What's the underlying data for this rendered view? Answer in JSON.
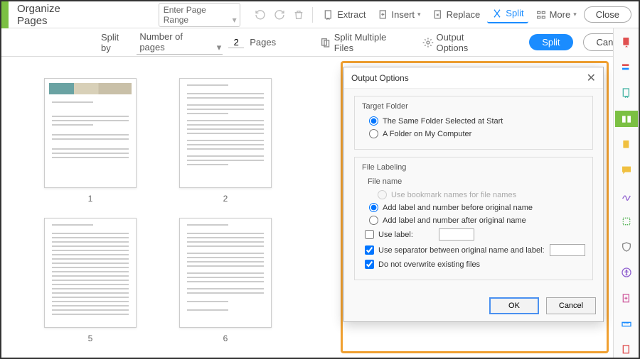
{
  "topbar": {
    "title": "Organize Pages",
    "page_range": "Enter Page Range",
    "extract": "Extract",
    "insert": "Insert",
    "replace": "Replace",
    "split": "Split",
    "more": "More",
    "close": "Close"
  },
  "secondbar": {
    "split_by": "Split by",
    "method": "Number of pages",
    "count": "2",
    "pages_label": "Pages",
    "multi": "Split Multiple Files",
    "output_opts": "Output Options",
    "split_btn": "Split",
    "cancel_btn": "Cancel"
  },
  "thumbs": {
    "p1": "1",
    "p2": "2",
    "p5": "5",
    "p6": "6"
  },
  "dialog": {
    "title": "Output Options",
    "target_folder": "Target Folder",
    "same_folder": "The Same Folder Selected at Start",
    "my_computer": "A Folder on My Computer",
    "file_labeling": "File Labeling",
    "file_name": "File name",
    "bookmark_names": "Use bookmark names for file names",
    "before_name": "Add label and number before original name",
    "after_name": "Add label and number after original name",
    "use_label": "Use label:",
    "use_separator": "Use separator between original name and label:",
    "no_overwrite": "Do not overwrite existing files",
    "ok": "OK",
    "cancel": "Cancel"
  }
}
